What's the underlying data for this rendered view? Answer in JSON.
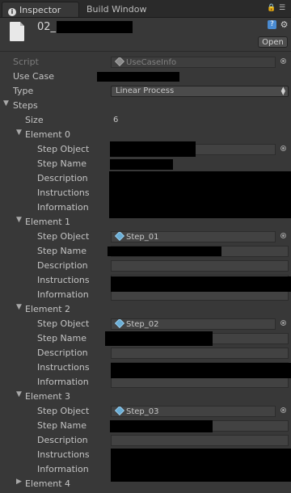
{
  "tabs": [
    {
      "label": "Inspector",
      "active": true,
      "icon": "info-icon"
    },
    {
      "label": "Build Window",
      "active": false
    }
  ],
  "header": {
    "object_name": "02_",
    "open_button": "Open",
    "icons": [
      "lock-icon",
      "menu-icon",
      "help-book-icon",
      "gear-icon"
    ]
  },
  "script_row": {
    "label": "Script",
    "value": "UseCaseInfo"
  },
  "use_case": {
    "label": "Use Case"
  },
  "type": {
    "label": "Type",
    "value": "Linear Process"
  },
  "steps": {
    "label": "Steps",
    "size_label": "Size",
    "size_value": "6",
    "field_labels": {
      "step_object": "Step Object",
      "step_name": "Step Name",
      "description": "Description",
      "instructions": "Instructions",
      "information": "Information"
    },
    "elements": [
      {
        "label": "Element 0",
        "step_object": ""
      },
      {
        "label": "Element 1",
        "step_object": "Step_01"
      },
      {
        "label": "Element 2",
        "step_object": "Step_02"
      },
      {
        "label": "Element 3",
        "step_object": "Step_03"
      },
      {
        "label": "Element 4"
      }
    ]
  },
  "colors": {
    "background": "#383838",
    "tab_bar": "#2a2a2a",
    "field": "#424242",
    "redaction": "#000000",
    "object_icon": "#6aaed6"
  }
}
